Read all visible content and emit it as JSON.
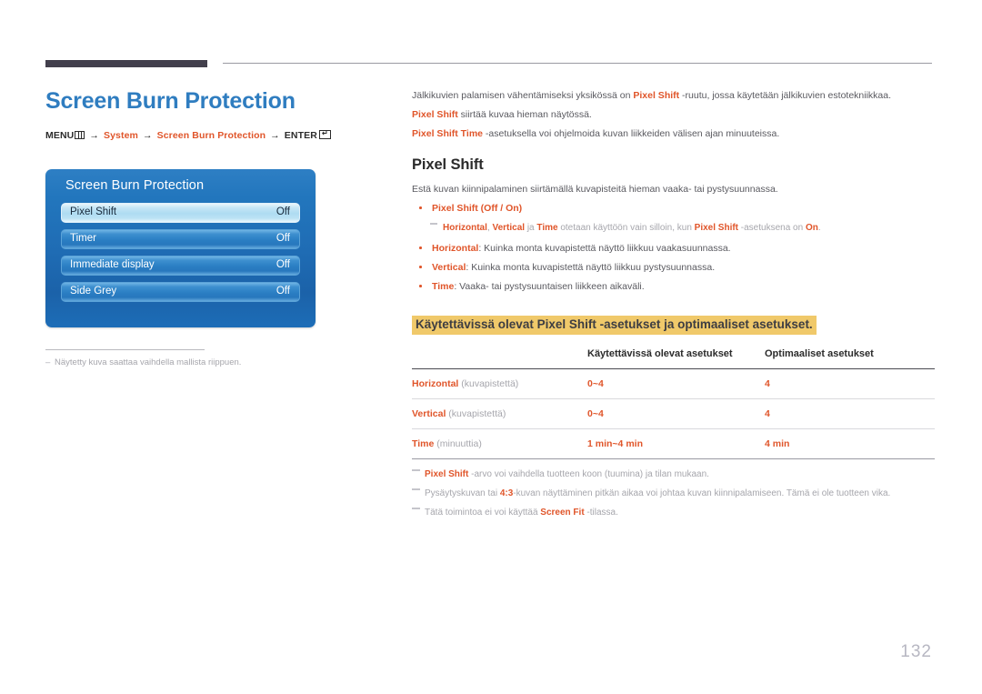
{
  "document": {
    "page_number": "132",
    "title": "Screen Burn Protection",
    "breadcrumb": {
      "menu_label": "MENU",
      "menu_icon": "menu-grid-icon",
      "arrow": "→",
      "step1": "System",
      "step2": "Screen Burn Protection",
      "enter_label": "ENTER",
      "enter_icon": "enter-return-icon"
    }
  },
  "osd": {
    "title": "Screen Burn Protection",
    "rows": [
      {
        "label": "Pixel Shift",
        "value": "Off",
        "selected": true
      },
      {
        "label": "Timer",
        "value": "Off",
        "selected": false
      },
      {
        "label": "Immediate display",
        "value": "Off",
        "selected": false
      },
      {
        "label": "Side Grey",
        "value": "Off",
        "selected": false
      }
    ],
    "note": "Näytetty kuva saattaa vaihdella mallista riippuen."
  },
  "intro": {
    "p1_a": "Jälkikuvien palamisen vähentämiseksi yksikössä on ",
    "p1_b": "Pixel Shift",
    "p1_c": " -ruutu, jossa käytetään jälkikuvien estotekniikkaa.",
    "p2_a": "Pixel Shift",
    "p2_b": " siirtää kuvaa hieman näytössä.",
    "p3_a": "Pixel Shift Time",
    "p3_b": " -asetuksella voi ohjelmoida kuvan liikkeiden välisen ajan minuuteissa."
  },
  "section": {
    "heading": "Pixel Shift",
    "intro": "Estä kuvan kiinnipalaminen siirtämällä kuvapisteitä hieman vaaka- tai pystysuunnassa.",
    "bullets": [
      {
        "term": "Pixel Shift",
        "rest": " (Off / On)",
        "options": [
          "Off",
          "On"
        ]
      },
      {
        "term": "Horizontal",
        "rest": ": Kuinka monta kuvapistettä näyttö liikkuu vaakasuunnassa."
      },
      {
        "term": "Vertical",
        "rest": ": Kuinka monta kuvapistettä näyttö liikkuu pystysuunnassa."
      },
      {
        "term": "Time",
        "rest": ": Vaaka- tai pystysuuntaisen liikkeen aikaväli."
      }
    ],
    "subnote": {
      "t1": "Horizontal",
      "s1": ", ",
      "t2": "Vertical",
      "s2": " ja ",
      "t3": "Time",
      "s3": " otetaan käyttöön vain silloin, kun ",
      "t4": "Pixel Shift",
      "s4": " -asetuksena on ",
      "t5": "On",
      "s5": "."
    }
  },
  "band": {
    "text": "Käytettävissä olevat Pixel Shift -asetukset ja optimaaliset asetukset.",
    "background": "#f0c96a"
  },
  "table": {
    "headers": [
      "",
      "Käytettävissä olevat asetukset",
      "Optimaaliset asetukset"
    ],
    "rows": [
      {
        "label": "Horizontal",
        "unit": " (kuvapistettä)",
        "available": "0~4",
        "optimal": "4"
      },
      {
        "label": "Vertical",
        "unit": " (kuvapistettä)",
        "available": "0~4",
        "optimal": "4"
      },
      {
        "label": "Time",
        "unit": " (minuuttia)",
        "available": "1 min~4 min",
        "optimal": "4 min"
      }
    ]
  },
  "footnotes": [
    {
      "a": "Pixel Shift",
      "b": " -arvo voi vaihdella tuotteen koon (tuumina) ja tilan mukaan.",
      "accent_first": true
    },
    {
      "a": "Pysäytyskuvan tai ",
      "b": "4:3",
      "c": "-kuvan näyttäminen pitkän aikaa voi johtaa kuvan kiinnipalamiseen. Tämä ei ole tuotteen vika.",
      "accent_first": false
    },
    {
      "a": "Tätä toimintoa ei voi käyttää ",
      "b": "Screen Fit",
      "c": " -tilassa.",
      "accent_first": false
    }
  ],
  "colors": {
    "accent_orange": "#e0552a",
    "title_blue": "#2f7dc0",
    "band_yellow": "#f0c96a",
    "rule_dark": "#423f4c",
    "muted_grey": "#a6a6ac"
  }
}
